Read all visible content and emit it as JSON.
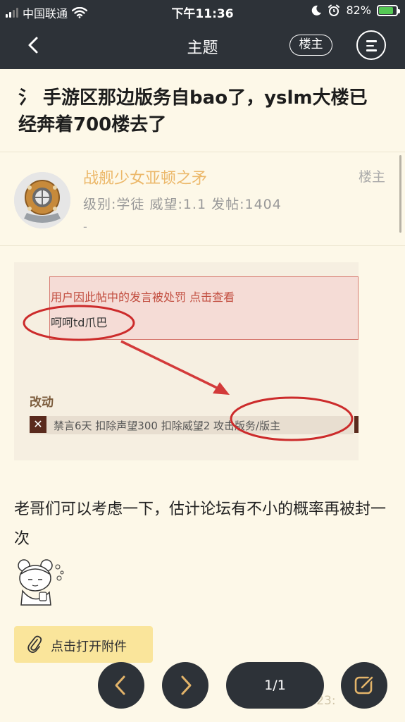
{
  "status_bar": {
    "carrier": "中国联通",
    "time": "下午11:36",
    "battery": "82%",
    "battery_level": 0.82
  },
  "nav": {
    "title": "主题",
    "owner_button": "楼主"
  },
  "thread": {
    "title": "氵 手游区那边版务自bao了，yslm大楼已经奔着700楼去了"
  },
  "author": {
    "name": "战舰少女亚顿之矛",
    "tag": "楼主",
    "stats": "级别:学徒  威望:1.1  发帖:1404",
    "extra": "-"
  },
  "embedded_image": {
    "punish_text": "用户因此帖中的发言被处罚 点击查看",
    "quote_text": "呵呵td爪巴",
    "section_label": "改动",
    "x_mark": "✕",
    "detail_text": "禁言6天 扣除声望300 扣除威望2 攻击版务/版主"
  },
  "post": {
    "body": "老哥们可以考虑一下，估计论坛有不小的概率再被封一次"
  },
  "attachment": {
    "label": "点击打开附件"
  },
  "footer": {
    "timestamp": "2020-04-16 23:",
    "page_indicator": "1/1"
  },
  "colors": {
    "bar": "#2d3238",
    "background": "#fdf8e8",
    "author_name": "#ecb86a",
    "attachment": "#fae59b"
  }
}
